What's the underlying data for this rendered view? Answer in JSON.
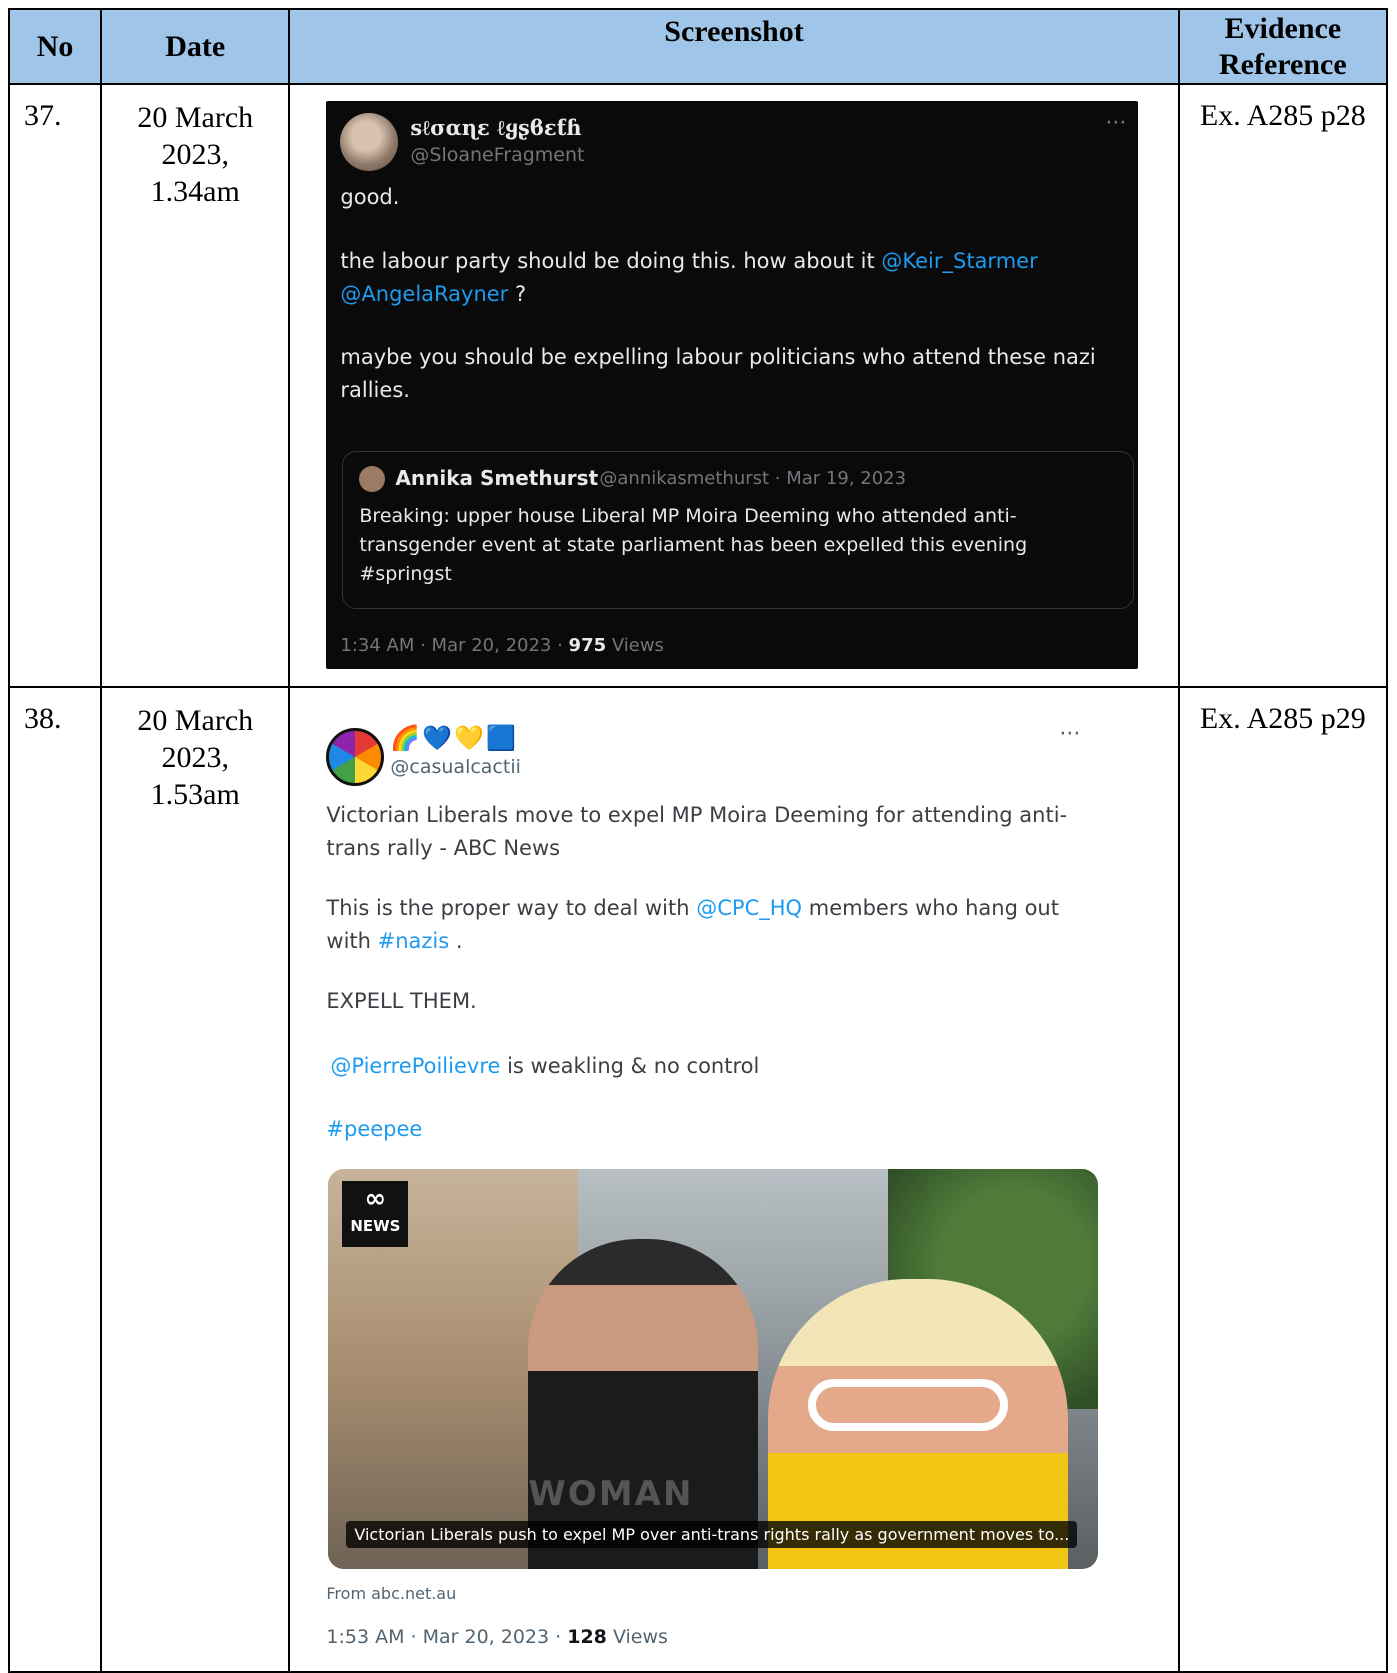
{
  "headers": {
    "no": "No",
    "date": "Date",
    "screenshot": "Screenshot",
    "evidence": "Evidence Reference"
  },
  "rows": [
    {
      "no": "37.",
      "date_lines": [
        "20 March",
        "2023,",
        "1.34am"
      ],
      "reference": "Ex. A285 p28",
      "tweet": {
        "theme": "dark",
        "display_name": "ꜱℓσαɳε ℓყʂϐεƭɦ",
        "handle": "@SloaneFragment",
        "more": "···",
        "para1": "good.",
        "para2_pre": "the labour party should be doing this. how about it ",
        "mention1": "@Keir_Starmer",
        "mention2": "@AngelaRayner",
        "para2_post": " ?",
        "para3": "maybe you should be expelling labour politicians who attend these nazi rallies.",
        "quote": {
          "name": "Annika Smethurst",
          "meta": "@annikasmethurst · Mar 19, 2023",
          "text": "Breaking: upper house Liberal MP Moira Deeming who attended anti-transgender event at state parliament has been expelled this evening #springst"
        },
        "footer_time": "1:34 AM · Mar 20, 2023 · ",
        "views_count": "975",
        "views_label": " Views"
      }
    },
    {
      "no": "38.",
      "date_lines": [
        "20 March",
        "2023,",
        "1.53am"
      ],
      "reference": "Ex. A285 p29",
      "tweet": {
        "theme": "light",
        "display_name": "🌈💙💛🟦",
        "handle": "@casualcactii",
        "more": "···",
        "para1": "Victorian Liberals move to expel MP Moira Deeming for attending anti-trans rally - ABC News",
        "para2_pre": "This is the proper way to deal with ",
        "mention1": "@CPC_HQ",
        "para2_mid": " members who hang out with ",
        "hashtag1": "#nazis",
        "para2_post": " .",
        "para3": "EXPELL THEM.",
        "mention2": "@PierrePoilievre",
        "para4_post": " is weakling & no control",
        "hashtag2": "#peepee",
        "card": {
          "logo": "NEWS",
          "shirt_text": "WOMAN",
          "caption": "Victorian Liberals push to expel MP over anti-trans rights rally as government moves to...",
          "from": "From abc.net.au"
        },
        "footer_time": "1:53 AM · Mar 20, 2023 · ",
        "views_count": "128",
        "views_label": " Views"
      }
    }
  ]
}
